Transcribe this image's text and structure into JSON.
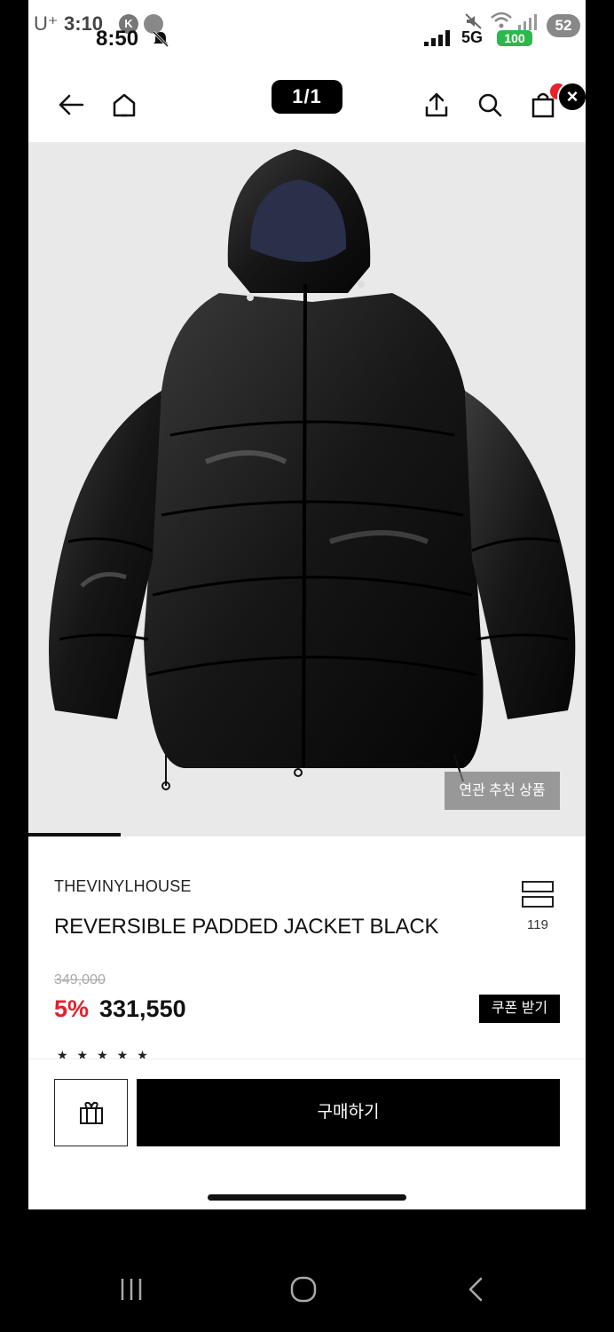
{
  "status_bar": {
    "carrier": "U⁺",
    "time_back": "3:10",
    "time_front": "8:50",
    "app_badge_1": "K",
    "network": "5G",
    "battery": "100",
    "notification_count": "52"
  },
  "nav": {
    "image_counter": "1/1",
    "close": "×"
  },
  "image": {
    "related_button": "연관 추천 상품",
    "progress": 0.165
  },
  "product": {
    "brand": "THEVINYLHOUSE",
    "title": "REVERSIBLE PADDED JACKET BLACK",
    "compare_count": "119",
    "original_price": "349,000",
    "discount": "5%",
    "price": "331,550",
    "coupon_button": "쿠폰 받기",
    "stars": "★★★★★"
  },
  "actions": {
    "buy_button": "구매하기"
  },
  "colors": {
    "accent_red": "#e51f2a",
    "battery_green": "#2db84d",
    "image_bg": "#e9e9e9"
  }
}
